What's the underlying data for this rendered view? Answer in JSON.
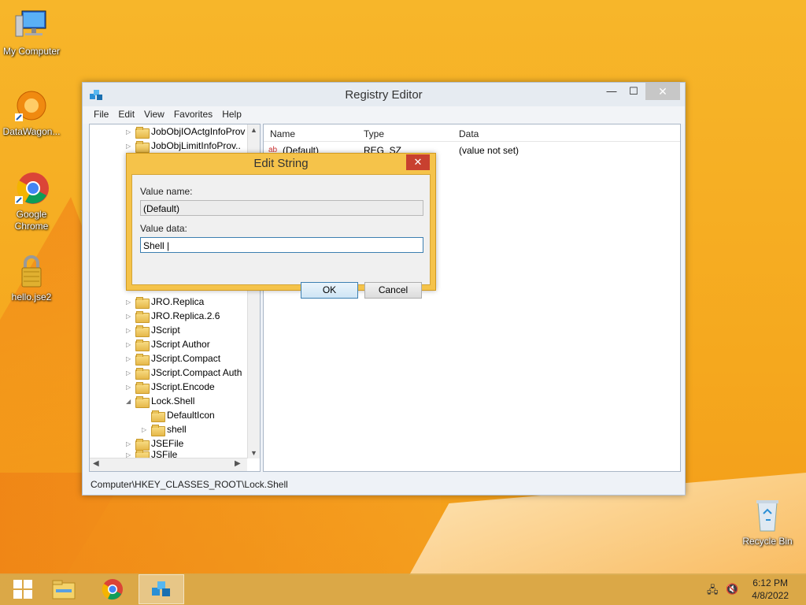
{
  "desktop": {
    "icons": [
      {
        "label": "My Computer"
      },
      {
        "label": "DataWagon..."
      },
      {
        "label": "Google Chrome"
      },
      {
        "label": "hello.jse2"
      },
      {
        "label": "Recycle Bin"
      }
    ]
  },
  "window": {
    "title": "Registry Editor",
    "menu": [
      "File",
      "Edit",
      "View",
      "Favorites",
      "Help"
    ],
    "tree": [
      {
        "label": "JobObjIOActgInfoProv",
        "exp": "▷"
      },
      {
        "label": "JobObjLimitInfoProv..",
        "exp": "▷"
      },
      {
        "label": "JRO.Replica",
        "exp": "▷"
      },
      {
        "label": "JRO.Replica.2.6",
        "exp": "▷"
      },
      {
        "label": "JScript",
        "exp": "▷"
      },
      {
        "label": "JScript Author",
        "exp": "▷"
      },
      {
        "label": "JScript.Compact",
        "exp": "▷"
      },
      {
        "label": "JScript.Compact Auth",
        "exp": "▷"
      },
      {
        "label": "JScript.Encode",
        "exp": "▷"
      },
      {
        "label": "Lock.Shell",
        "exp": "◢"
      },
      {
        "label": "DefaultIcon",
        "exp": ""
      },
      {
        "label": "shell",
        "exp": "▷"
      },
      {
        "label": "JSEFile",
        "exp": "▷"
      },
      {
        "label": "JSFile",
        "exp": "▷"
      }
    ],
    "columns": {
      "name": "Name",
      "type": "Type",
      "data": "Data"
    },
    "rows": [
      {
        "name": "(Default)",
        "type": "REG_SZ",
        "data": "(value not set)"
      }
    ],
    "status": "Computer\\HKEY_CLASSES_ROOT\\Lock.Shell"
  },
  "dialog": {
    "title": "Edit String",
    "value_name_label": "Value name:",
    "value_name": "(Default)",
    "value_data_label": "Value data:",
    "value_data": "Shell |",
    "ok": "OK",
    "cancel": "Cancel"
  },
  "taskbar": {
    "time": "6:12 PM",
    "date": "4/8/2022"
  }
}
